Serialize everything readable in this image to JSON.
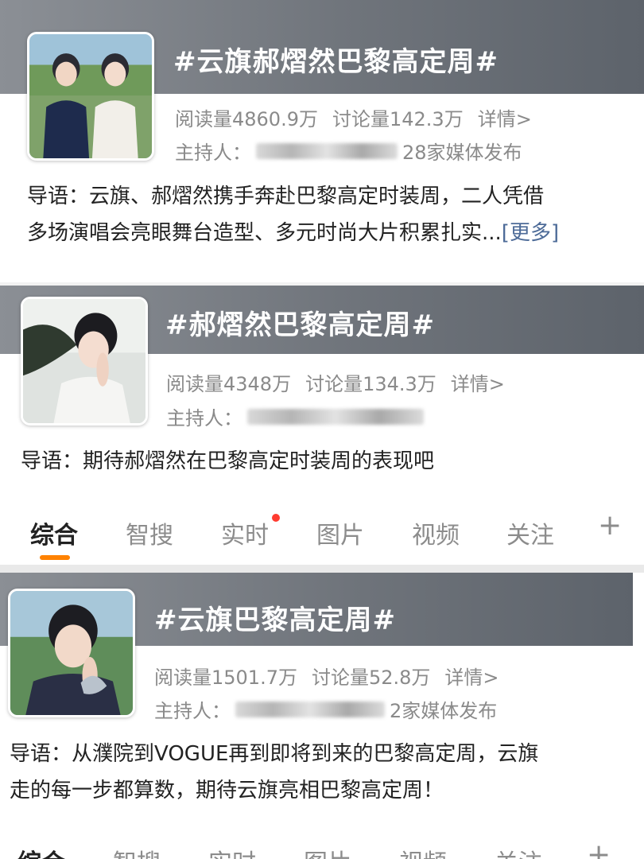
{
  "cards": [
    {
      "title": "#云旗郝熠然巴黎高定周#",
      "reads": "阅读量4860.9万",
      "discussion": "讨论量142.3万",
      "detail": "详情>",
      "host_label": "主持人：",
      "media": "28家媒体发布",
      "intro_lines": [
        "导语：云旗、郝熠然携手奔赴巴黎高定时装周，二人凭借",
        "多场演唱会亮眼舞台造型、多元时尚大片积累扎实..."
      ],
      "more": "[更多]"
    },
    {
      "title": "#郝熠然巴黎高定周#",
      "reads": "阅读量4348万",
      "discussion": "讨论量134.3万",
      "detail": "详情>",
      "host_label": "主持人：",
      "intro_lines": [
        "导语：期待郝熠然在巴黎高定时装周的表现吧"
      ]
    },
    {
      "title": "#云旗巴黎高定周#",
      "reads": "阅读量1501.7万",
      "discussion": "讨论量52.8万",
      "detail": "详情>",
      "host_label": "主持人：",
      "media": "2家媒体发布",
      "intro_lines": [
        "导语：从濮院到VOGUE再到即将到来的巴黎高定周，云旗",
        "走的每一步都算数，期待云旗亮相巴黎高定周！"
      ]
    }
  ],
  "tabs": [
    "综合",
    "智搜",
    "实时",
    "图片",
    "视频",
    "关注"
  ],
  "tab_add": "+",
  "colors": {
    "accent": "#ff8200",
    "more_link": "#4d6b98",
    "badge_dot": "#ff3b30"
  }
}
